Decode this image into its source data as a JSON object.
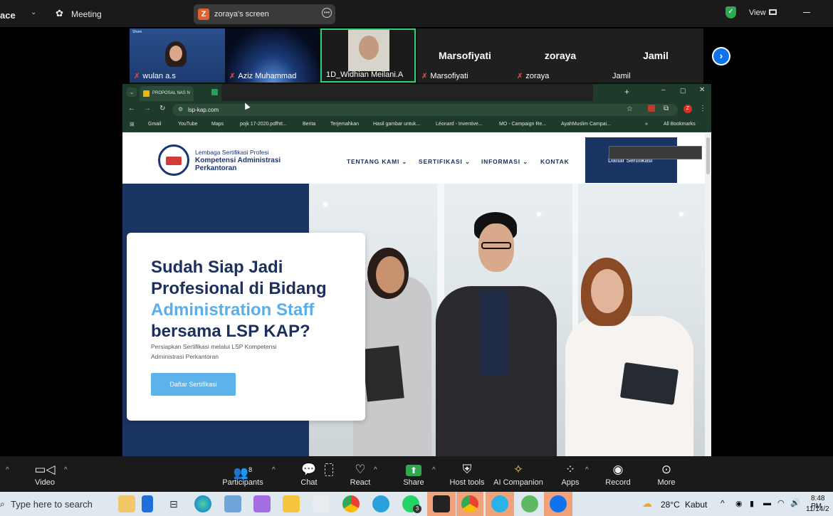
{
  "zoom": {
    "top": {
      "left_fragment": "ace",
      "meeting_label": "Meeting",
      "screen_pill": {
        "badge": "Z",
        "label": "zoraya's screen"
      },
      "view_label": "View"
    },
    "participants": [
      {
        "name": "wulan a.s",
        "type": "video",
        "share_tag": "Share"
      },
      {
        "name": "Aziz Muhammad",
        "type": "video"
      },
      {
        "name": "1D_Widhian Meilani.A",
        "type": "video",
        "active": true
      },
      {
        "name": "Marsofiyati",
        "display": "Marsofiyati",
        "type": "name"
      },
      {
        "name": "zoraya",
        "display": "zoraya",
        "type": "name"
      },
      {
        "name": "Jamil",
        "display": "Jamil",
        "type": "name"
      }
    ],
    "toolbar": {
      "video": "Video",
      "participants": "Participants",
      "participants_count": "8",
      "chat": "Chat",
      "react": "React",
      "share": "Share",
      "host_tools": "Host tools",
      "ai_companion": "AI Companion",
      "apps": "Apps",
      "record": "Record",
      "more": "More"
    }
  },
  "browser": {
    "tab1": "PROPOSAL NAS N",
    "url": "lsp-kap.com",
    "profile_initial": "Z",
    "bookmarks": [
      "Gmail",
      "YouTube",
      "Maps",
      "pojk 17-2020.pdfhtt...",
      "Berita",
      "Terjemahkan",
      "Hasil gambar untuk...",
      "Léonard - Inventive...",
      "MO - Campaign Re...",
      "AyahMuslim Campai..."
    ],
    "all_bookmarks": "All Bookmarks"
  },
  "site": {
    "logo": {
      "line1": "Lembaga Sertifikasi Profesi",
      "line2": "Kompetensi Administrasi",
      "line3": "Perkantoran"
    },
    "nav": [
      "TENTANG KAMI",
      "SERTIFIKASI",
      "INFORMASI",
      "KONTAK"
    ],
    "nav_cta": "Daftar Sertifikasi",
    "hero": {
      "line1": "Sudah Siap Jadi",
      "line2": "Profesional di Bidang",
      "line3": "Administration Staff",
      "line4": "bersama LSP KAP?",
      "sub1": "Persiapkan Sertifikasi melalui LSP Kompetensi",
      "sub2": "Administrasi Perkantoran",
      "button": "Daftar Sertifikasi"
    }
  },
  "taskbar": {
    "search_placeholder": "Type here to search",
    "weather": "28°C",
    "weather_desc": "Kabut",
    "time": "8:48 PM",
    "date": "11/14/2",
    "whatsapp_badge": "3"
  },
  "colors": {
    "navy": "#1a3464",
    "accent_blue": "#5eb2ec",
    "zoom_bg": "#1a1a1a",
    "share_green": "#2da84f"
  }
}
